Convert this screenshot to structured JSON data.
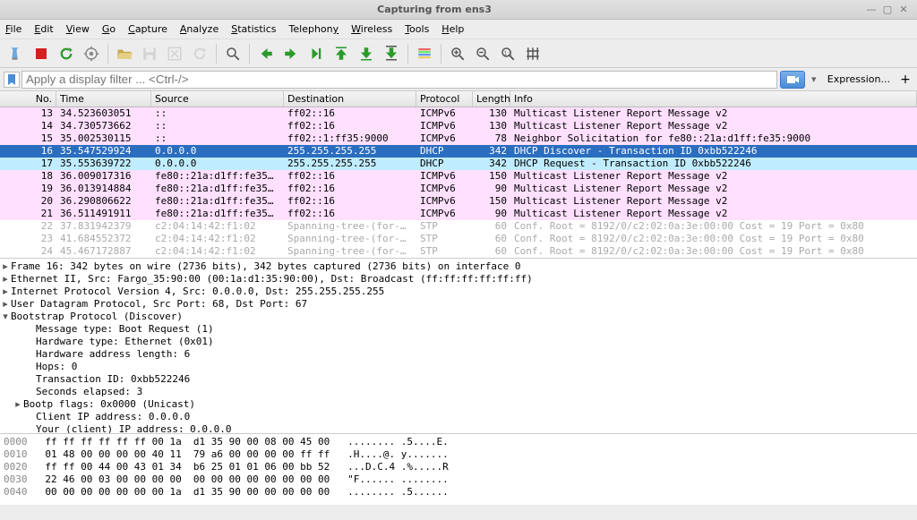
{
  "window": {
    "title": "Capturing from ens3"
  },
  "menu": [
    "File",
    "Edit",
    "View",
    "Go",
    "Capture",
    "Analyze",
    "Statistics",
    "Telephony",
    "Wireless",
    "Tools",
    "Help"
  ],
  "filter": {
    "placeholder": "Apply a display filter ... <Ctrl-/>",
    "expression_label": "Expression..."
  },
  "columns": {
    "no": "No.",
    "time": "Time",
    "src": "Source",
    "dst": "Destination",
    "proto": "Protocol",
    "len": "Length",
    "info": "Info"
  },
  "packets": [
    {
      "no": "13",
      "time": "34.523603051",
      "src": "::",
      "dst": "ff02::16",
      "proto": "ICMPv6",
      "len": "130",
      "info": "Multicast Listener Report Message v2",
      "cls": "row-pink"
    },
    {
      "no": "14",
      "time": "34.730573662",
      "src": "::",
      "dst": "ff02::16",
      "proto": "ICMPv6",
      "len": "130",
      "info": "Multicast Listener Report Message v2",
      "cls": "row-pink"
    },
    {
      "no": "15",
      "time": "35.002530115",
      "src": "::",
      "dst": "ff02::1:ff35:9000",
      "proto": "ICMPv6",
      "len": "78",
      "info": "Neighbor Solicitation for fe80::21a:d1ff:fe35:9000",
      "cls": "row-pink"
    },
    {
      "no": "16",
      "time": "35.547529924",
      "src": "0.0.0.0",
      "dst": "255.255.255.255",
      "proto": "DHCP",
      "len": "342",
      "info": "DHCP Discover - Transaction ID 0xbb522246",
      "cls": "row-sel"
    },
    {
      "no": "17",
      "time": "35.553639722",
      "src": "0.0.0.0",
      "dst": "255.255.255.255",
      "proto": "DHCP",
      "len": "342",
      "info": "DHCP Request  - Transaction ID 0xbb522246",
      "cls": "row-cyan"
    },
    {
      "no": "18",
      "time": "36.009017316",
      "src": "fe80::21a:d1ff:fe35…",
      "dst": "ff02::16",
      "proto": "ICMPv6",
      "len": "150",
      "info": "Multicast Listener Report Message v2",
      "cls": "row-pink"
    },
    {
      "no": "19",
      "time": "36.013914884",
      "src": "fe80::21a:d1ff:fe35…",
      "dst": "ff02::16",
      "proto": "ICMPv6",
      "len": "90",
      "info": "Multicast Listener Report Message v2",
      "cls": "row-pink"
    },
    {
      "no": "20",
      "time": "36.290806622",
      "src": "fe80::21a:d1ff:fe35…",
      "dst": "ff02::16",
      "proto": "ICMPv6",
      "len": "150",
      "info": "Multicast Listener Report Message v2",
      "cls": "row-pink"
    },
    {
      "no": "21",
      "time": "36.511491911",
      "src": "fe80::21a:d1ff:fe35…",
      "dst": "ff02::16",
      "proto": "ICMPv6",
      "len": "90",
      "info": "Multicast Listener Report Message v2",
      "cls": "row-pink"
    },
    {
      "no": "22",
      "time": "37.831942379",
      "src": "c2:04:14:42:f1:02",
      "dst": "Spanning-tree-(for-…",
      "proto": "STP",
      "len": "60",
      "info": "Conf. Root = 8192/0/c2:02:0a:3e:00:00  Cost = 19   Port = 0x80",
      "cls": "row-gray"
    },
    {
      "no": "23",
      "time": "41.684552372",
      "src": "c2:04:14:42:f1:02",
      "dst": "Spanning-tree-(for-…",
      "proto": "STP",
      "len": "60",
      "info": "Conf. Root = 8192/0/c2:02:0a:3e:00:00  Cost = 19   Port = 0x80",
      "cls": "row-gray"
    },
    {
      "no": "24",
      "time": "45.467172887",
      "src": "c2:04:14:42:f1:02",
      "dst": "Spanning-tree-(for-…",
      "proto": "STP",
      "len": "60",
      "info": "Conf. Root = 8192/0/c2:02:0a:3e:00:00  Cost = 19   Port = 0x80",
      "cls": "row-gray"
    }
  ],
  "details": [
    {
      "tw": "▸",
      "ind": 0,
      "text": "Frame 16: 342 bytes on wire (2736 bits), 342 bytes captured (2736 bits) on interface 0"
    },
    {
      "tw": "▸",
      "ind": 0,
      "text": "Ethernet II, Src: Fargo_35:90:00 (00:1a:d1:35:90:00), Dst: Broadcast (ff:ff:ff:ff:ff:ff)"
    },
    {
      "tw": "▸",
      "ind": 0,
      "text": "Internet Protocol Version 4, Src: 0.0.0.0, Dst: 255.255.255.255"
    },
    {
      "tw": "▸",
      "ind": 0,
      "text": "User Datagram Protocol, Src Port: 68, Dst Port: 67"
    },
    {
      "tw": "▾",
      "ind": 0,
      "text": "Bootstrap Protocol (Discover)"
    },
    {
      "tw": "",
      "ind": 2,
      "text": "Message type: Boot Request (1)"
    },
    {
      "tw": "",
      "ind": 2,
      "text": "Hardware type: Ethernet (0x01)"
    },
    {
      "tw": "",
      "ind": 2,
      "text": "Hardware address length: 6"
    },
    {
      "tw": "",
      "ind": 2,
      "text": "Hops: 0"
    },
    {
      "tw": "",
      "ind": 2,
      "text": "Transaction ID: 0xbb522246"
    },
    {
      "tw": "",
      "ind": 2,
      "text": "Seconds elapsed: 3"
    },
    {
      "tw": "▸",
      "ind": 1,
      "text": "Bootp flags: 0x0000 (Unicast)"
    },
    {
      "tw": "",
      "ind": 2,
      "text": "Client IP address: 0.0.0.0"
    },
    {
      "tw": "",
      "ind": 2,
      "text": "Your (client) IP address: 0.0.0.0"
    }
  ],
  "hex": [
    {
      "off": "0000",
      "bytes": "ff ff ff ff ff ff 00 1a  d1 35 90 00 08 00 45 00",
      "ascii": "   ........ .5....E."
    },
    {
      "off": "0010",
      "bytes": "01 48 00 00 00 00 40 11  79 a6 00 00 00 00 ff ff",
      "ascii": "   .H....@. y......."
    },
    {
      "off": "0020",
      "bytes": "ff ff 00 44 00 43 01 34  b6 25 01 01 06 00 bb 52",
      "ascii": "   ...D.C.4 .%.....R"
    },
    {
      "off": "0030",
      "bytes": "22 46 00 03 00 00 00 00  00 00 00 00 00 00 00 00",
      "ascii": "   \"F...... ........"
    },
    {
      "off": "0040",
      "bytes": "00 00 00 00 00 00 00 1a  d1 35 90 00 00 00 00 00",
      "ascii": "   ........ .5......"
    }
  ]
}
